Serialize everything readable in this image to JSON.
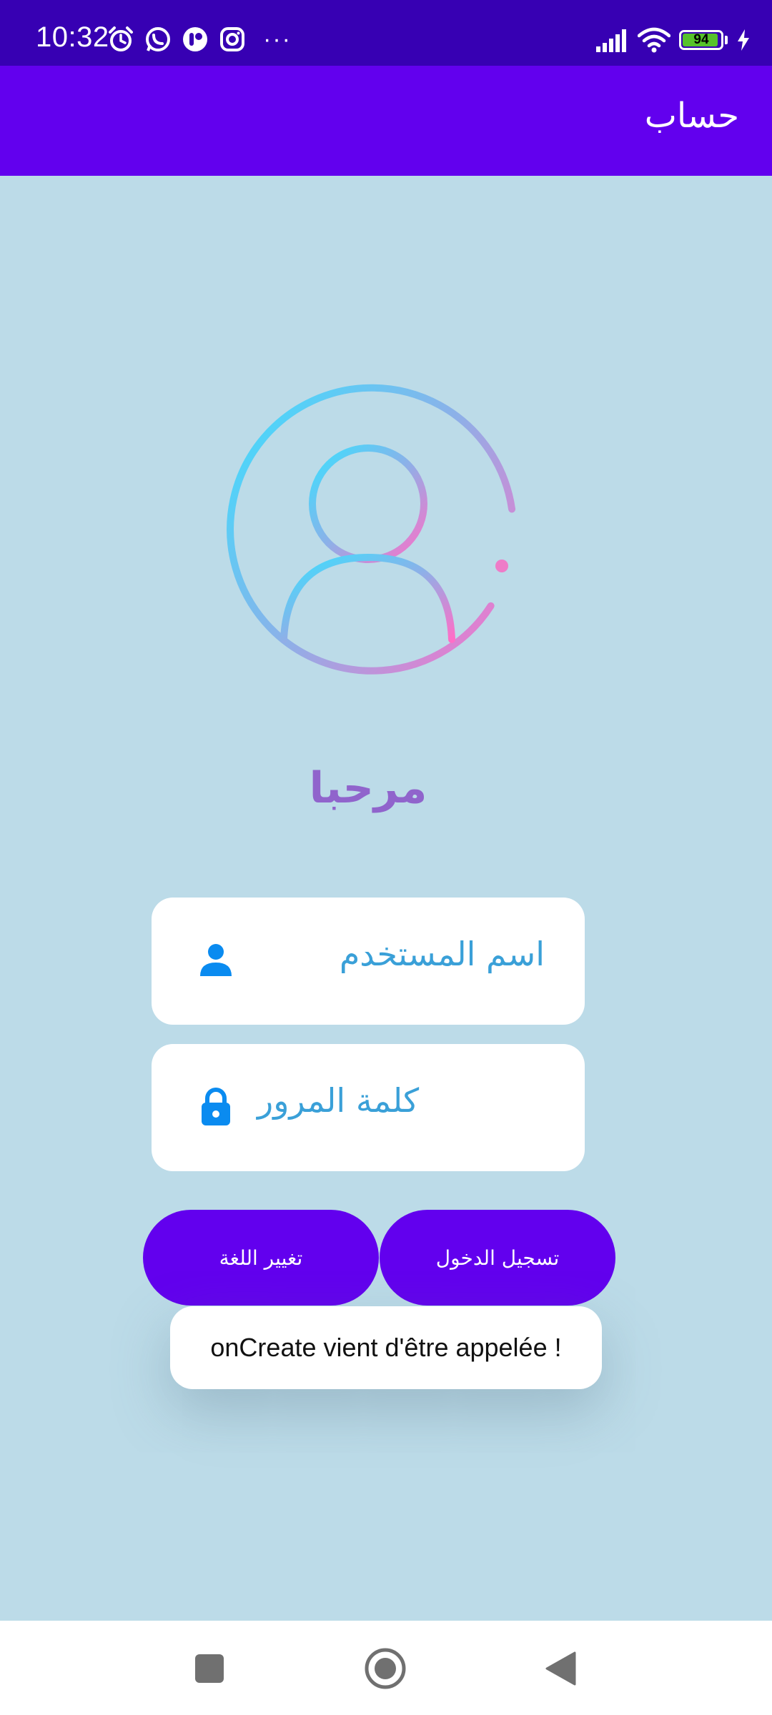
{
  "status_bar": {
    "time": "10:32",
    "left_icons": [
      "alarm-icon",
      "whatsapp-icon",
      "app-icon",
      "instagram-icon"
    ],
    "more": "···",
    "battery_level": "94",
    "battery_fraction": 0.94,
    "battery_color": "#56c22b"
  },
  "app_bar": {
    "title": "حساب",
    "color": "#6200ee"
  },
  "welcome": "مرحبا",
  "form": {
    "username_placeholder": "اسم المستخدم",
    "password_placeholder": "كلمة المرور"
  },
  "buttons": {
    "change_language": "تغيير اللغة",
    "login": "تسجيل الدخول"
  },
  "toast": "onCreate vient d'être appelée !",
  "colors": {
    "background": "#bcdbe8",
    "status_bar": "#3700b3",
    "accent": "#6200ee",
    "field_text": "#3aa0d8",
    "icon_blue": "#0a8bf0",
    "welcome": "#9064cc"
  },
  "nav": {
    "icons": [
      "recents-square-icon",
      "home-circle-icon",
      "back-triangle-icon"
    ]
  }
}
